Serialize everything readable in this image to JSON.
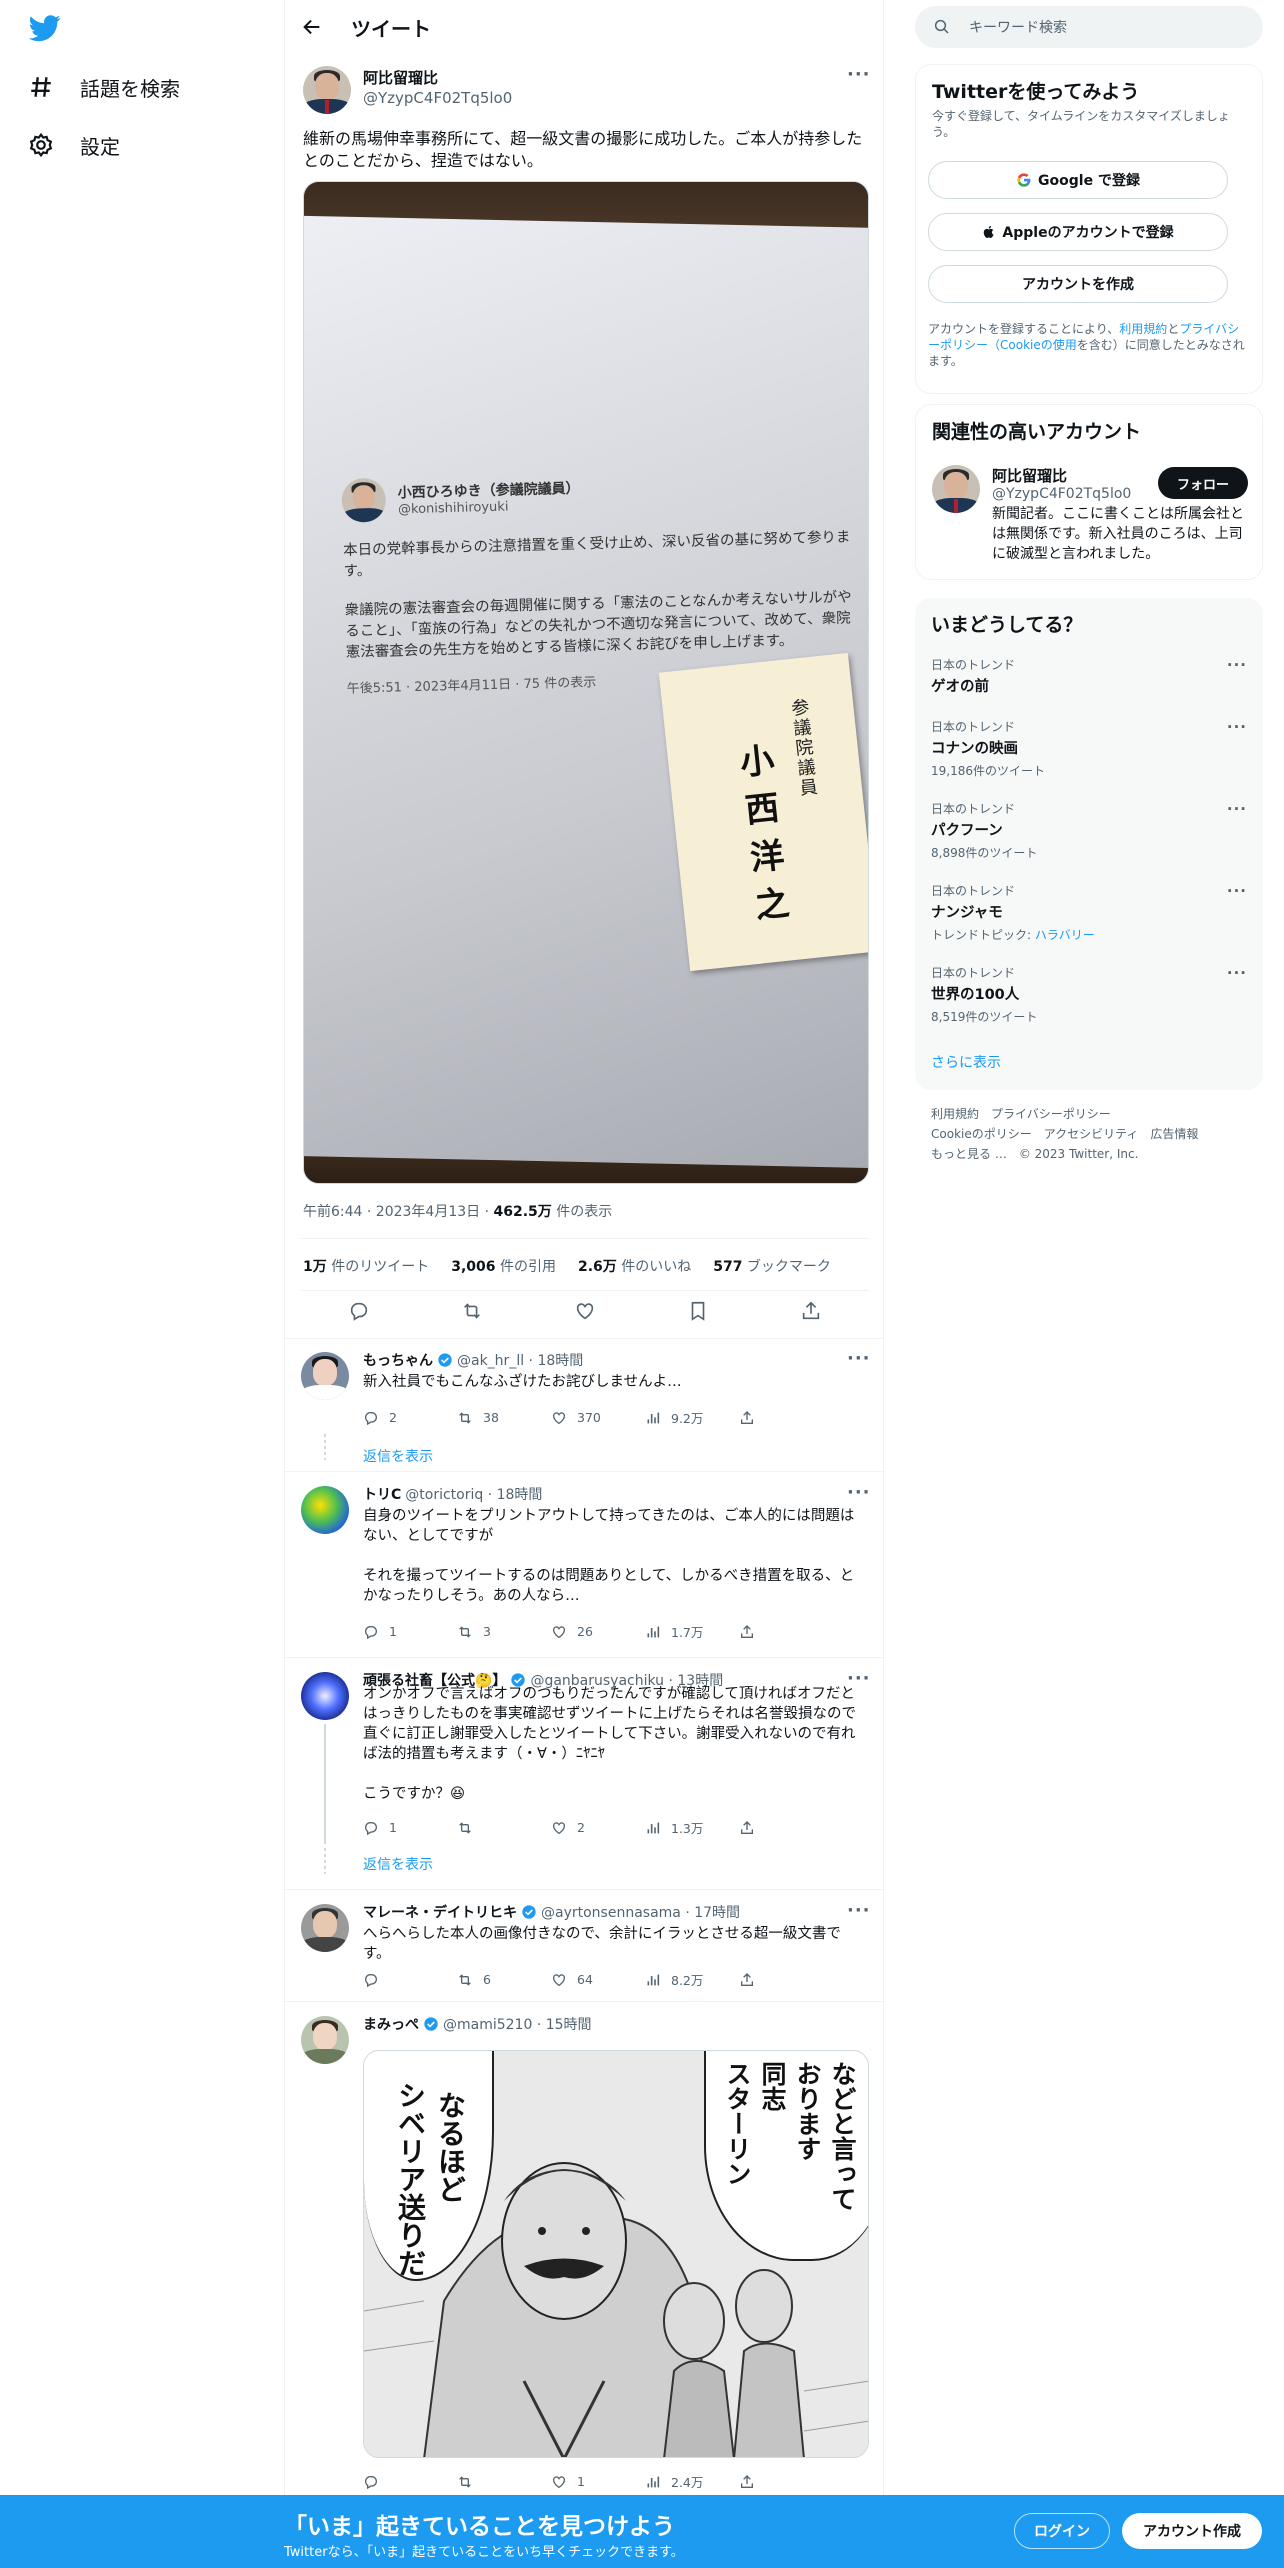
{
  "nav": {
    "explore": "話題を検索",
    "settings": "設定"
  },
  "header": {
    "title": "ツイート"
  },
  "tweet": {
    "name": "阿比留瑠比",
    "handle": "@YzypC4F02Tq5lo0",
    "text": "維新の馬場伸幸事務所にて、超一級文書の撮影に成功した。ご本人が持参したとのことだから、捏造ではない。",
    "photo": {
      "card_name": "小西ひろゆき（参議院議員）",
      "card_handle": "@konishihiroyuki",
      "card_p1": "本日の党幹事長からの注意措置を重く受け止め、深い反省の基に努めて参ります。",
      "card_p2": "衆議院の憲法審査会の毎週開催に関する「憲法のことなんか考えないサルがやること」、「蛮族の行為」などの失礼かつ不適切な発言について、改めて、衆院憲法審査会の先生方を始めとする皆様に深くお詫びを申し上げます。",
      "card_meta": "午後5:51 · 2023年4月11日 · 75 件の表示",
      "namecard_title": "参議院議員",
      "namecard_name": "小西洋之"
    },
    "time": "午前6:44 · 2023年4月13日 · ",
    "views": "462.5万",
    "views_label": " 件の表示",
    "retweets": "1万",
    "retweets_label": " 件のリツイート",
    "quotes": "3,006",
    "quotes_label": " 件の引用",
    "likes": "2.6万",
    "likes_label": " 件のいいね",
    "bookmarks": "577",
    "bookmarks_label": " ブックマーク"
  },
  "replies": [
    {
      "name": "もっちゃん",
      "handle": "@ak_hr_ll · 18時間",
      "text": "新入社員でもこんなふざけたお詫びしませんよ…",
      "reply": "2",
      "rt": "38",
      "like": "370",
      "views": "9.2万"
    },
    {
      "name": "トリC",
      "handle": "@torictoriq · 18時間",
      "text": "自身のツイートをプリントアウトして持ってきたのは、ご本人的には問題はない、としてですが\n\nそれを撮ってツイートするのは問題ありとして、しかるべき措置を取る、とかなったりしそう。あの人なら…",
      "reply": "1",
      "rt": "3",
      "like": "26",
      "views": "1.7万"
    },
    {
      "name": "頑張る社畜【公式🤔】",
      "handle": "@ganbarusyachiku · 13時間",
      "text": "オンかオフで言えばオフのつもりだったんですが確認して頂ければオフだとはっきりしたものを事実確認せずツイートに上げたらそれは名誉毀損なので直ぐに訂正し謝罪受入したとツイートして下さい。謝罪受入れないので有れば法的措置も考えます（・∀・）ﾆﾔﾆﾔ\n\nこうですか？😆",
      "reply": "1",
      "rt": "",
      "like": "2",
      "views": "1.3万"
    },
    {
      "name": "マレーネ・デイトリヒキ",
      "handle": "@ayrtonsennasama · 17時間",
      "text": "へらへらした本人の画像付きなので、余計にイラッとさせる超一級文書です。",
      "reply": "",
      "rt": "6",
      "like": "64",
      "views": "8.2万"
    },
    {
      "name": "まみっぺ",
      "handle": "@mami5210 · 15時間",
      "reply": "",
      "rt": "",
      "like": "1",
      "views": "2.4万"
    }
  ],
  "manga": {
    "t1": "などと言って",
    "t2": "おります",
    "t3": "同志",
    "t4": "スターリン",
    "t5": "なるほど",
    "t6": "シベリア送りだ"
  },
  "show_replies": "返信を表示",
  "search": {
    "placeholder": "キーワード検索"
  },
  "signup": {
    "title": "Twitterを使ってみよう",
    "sub": "今すぐ登録して、タイムラインをカスタマイズしましょう。",
    "google": "Google で登録",
    "apple": "Appleのアカウントで登録",
    "create": "アカウントを作成",
    "legal_1": "アカウントを登録することにより、",
    "legal_terms": "利用規約",
    "legal_2": "と",
    "legal_privacy": "プライバシーポリシー（Cookieの使用",
    "legal_3": "を含む）に同意したとみなされます。"
  },
  "recommended": {
    "title": "関連性の高いアカウント",
    "name": "阿比留瑠比",
    "handle": "@YzypC4F02Tq5lo0",
    "bio": "新聞記者。ここに書くことは所属会社とは無関係です。新入社員のころは、上司に破滅型と言われました。",
    "follow": "フォロー"
  },
  "trends": {
    "title": "いまどうしてる？",
    "items": [
      {
        "ctx": "日本のトレンド",
        "name": "ゲオの前",
        "count": ""
      },
      {
        "ctx": "日本のトレンド",
        "name": "コナンの映画",
        "count": "19,186件のツイート"
      },
      {
        "ctx": "日本のトレンド",
        "name": "パクフーン",
        "count": "8,898件のツイート"
      },
      {
        "ctx": "日本のトレンド",
        "name": "ナンジャモ",
        "count": "トレンドトピック: ",
        "link": "ハラバリー"
      },
      {
        "ctx": "日本のトレンド",
        "name": "世界の100人",
        "count": "8,519件のツイート"
      }
    ],
    "show_more": "さらに表示"
  },
  "footer": {
    "terms": "利用規約",
    "privacy": "プライバシーポリシー",
    "cookie": "Cookieのポリシー",
    "access": "アクセシビリティ",
    "ads": "広告情報",
    "more": "もっと見る …",
    "copy": "© 2023 Twitter, Inc."
  },
  "bottom": {
    "title": "「いま」起きていることを見つけよう",
    "sub": "Twitterなら、「いま」起きていることをいち早くチェックできます。",
    "login": "ログイン",
    "signup": "アカウント作成"
  },
  "colors": {
    "accent": "#1d9bf0",
    "text": "#0f1419",
    "muted": "#536471"
  }
}
